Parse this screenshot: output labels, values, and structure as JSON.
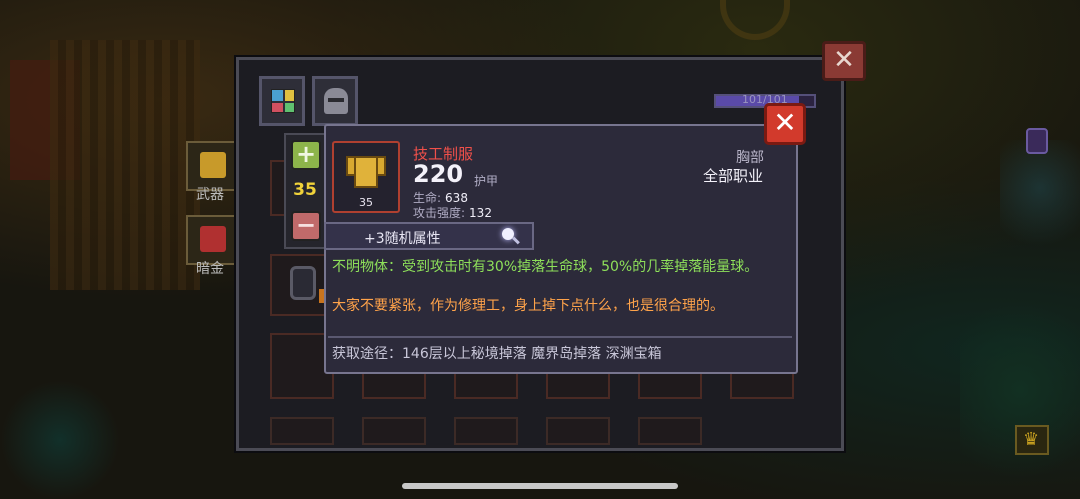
{
  "scene": {
    "side_buttons": [
      {
        "label": "武器",
        "color": "#c89a2a"
      },
      {
        "label": "暗金",
        "color": "#b03030"
      }
    ]
  },
  "panel": {
    "close_symbol": "✕",
    "tabs": [
      {
        "name": "bag",
        "icon": "grid-icon"
      },
      {
        "name": "equipment",
        "icon": "helmet-icon"
      }
    ],
    "progress": {
      "text": "101/101",
      "fill": 0.85
    }
  },
  "counter": {
    "plus": "+",
    "value": "35",
    "minus": "−"
  },
  "item": {
    "name": "技工制服",
    "level": "35",
    "value": "220",
    "value_label": "护甲",
    "stats": [
      {
        "label": "生命:",
        "value": "638"
      },
      {
        "label": "攻击强度:",
        "value": "132"
      }
    ],
    "slot_type": "胸部",
    "class": "全部职业",
    "random_attrs": "+3随机属性",
    "effect": "不明物体：受到攻击时有30%掉落生命球，50%的几率掉落能量球。",
    "flavor": "大家不要紧张，作为修理工，身上掉下点什么，也是很合理的。",
    "source": "获取途径：146层以上秘境掉落 魔界岛掉落 深渊宝箱",
    "close_symbol": "✕",
    "rarity_color": "#f0504a"
  }
}
